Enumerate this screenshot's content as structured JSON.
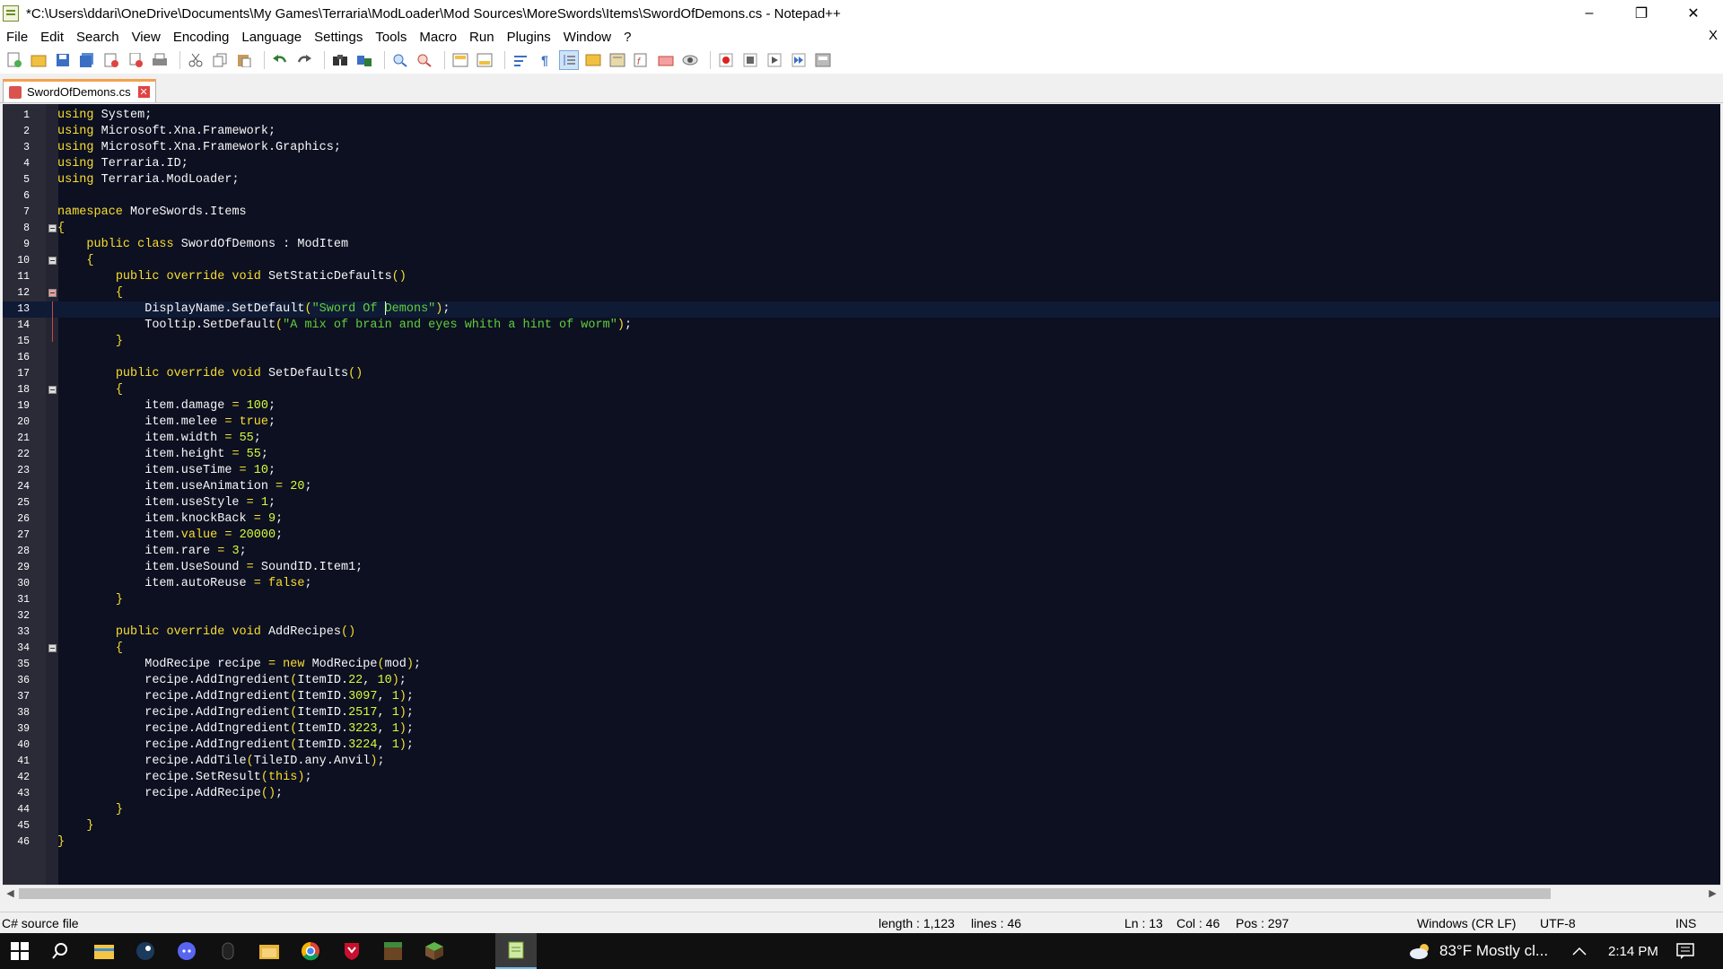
{
  "window": {
    "title": "*C:\\Users\\ddari\\OneDrive\\Documents\\My Games\\Terraria\\ModLoader\\Mod Sources\\MoreSwords\\Items\\SwordOfDemons.cs - Notepad++",
    "minimize": "–",
    "maximize": "❐",
    "close": "✕"
  },
  "menu": {
    "items": [
      "File",
      "Edit",
      "Search",
      "View",
      "Encoding",
      "Language",
      "Settings",
      "Tools",
      "Macro",
      "Run",
      "Plugins",
      "Window",
      "?"
    ],
    "close_doc": "X"
  },
  "toolbar": {
    "icons": [
      "new-file",
      "open-file",
      "save",
      "save-all",
      "close",
      "close-all",
      "print",
      "cut",
      "copy",
      "paste",
      "undo",
      "redo",
      "find",
      "replace",
      "zoom-in",
      "zoom-out",
      "sync-vertical",
      "sync-horizontal",
      "word-wrap",
      "show-all-chars",
      "indent-guide",
      "user-defined-language",
      "folder-as-workspace",
      "function-list",
      "document-map",
      "monitoring",
      "record-macro",
      "stop-recording",
      "play-macro",
      "run-macro-multiple",
      "save-macro"
    ]
  },
  "tab": {
    "label": "SwordOfDemons.cs"
  },
  "code": [
    [
      [
        "kw",
        "using"
      ],
      [
        "t",
        " System;"
      ]
    ],
    [
      [
        "kw",
        "using"
      ],
      [
        "t",
        " Microsoft.Xna.Framework;"
      ]
    ],
    [
      [
        "kw",
        "using"
      ],
      [
        "t",
        " Microsoft.Xna.Framework.Graphics;"
      ]
    ],
    [
      [
        "kw",
        "using"
      ],
      [
        "t",
        " Terraria.ID;"
      ]
    ],
    [
      [
        "kw",
        "using"
      ],
      [
        "t",
        " Terraria.ModLoader;"
      ]
    ],
    [],
    [
      [
        "kw",
        "namespace"
      ],
      [
        "t",
        " MoreSwords.Items"
      ]
    ],
    [
      [
        "kw",
        "{"
      ]
    ],
    [
      [
        "t",
        "    "
      ],
      [
        "kw",
        "public class"
      ],
      [
        "t",
        " SwordOfDemons : ModItem"
      ]
    ],
    [
      [
        "t",
        "    "
      ],
      [
        "kw",
        "{"
      ]
    ],
    [
      [
        "t",
        "        "
      ],
      [
        "kw",
        "public override void"
      ],
      [
        "t",
        " SetStaticDefaults"
      ],
      [
        "kw",
        "()"
      ]
    ],
    [
      [
        "t",
        "        "
      ],
      [
        "kw",
        "{"
      ]
    ],
    [
      [
        "t",
        "            DisplayName.SetDefault"
      ],
      [
        "kw",
        "("
      ],
      [
        "str",
        "\"Sword Of "
      ],
      [
        "caret",
        ""
      ],
      [
        "str",
        "Demons\""
      ],
      [
        "kw",
        ")"
      ],
      [
        "t",
        ";"
      ]
    ],
    [
      [
        "t",
        "            Tooltip.SetDefault"
      ],
      [
        "kw",
        "("
      ],
      [
        "str",
        "\"A mix of brain and eyes whith a hint of worm\""
      ],
      [
        "kw",
        ")"
      ],
      [
        "t",
        ";"
      ]
    ],
    [
      [
        "t",
        "        "
      ],
      [
        "kw",
        "}"
      ]
    ],
    [],
    [
      [
        "t",
        "        "
      ],
      [
        "kw",
        "public override void"
      ],
      [
        "t",
        " SetDefaults"
      ],
      [
        "kw",
        "()"
      ]
    ],
    [
      [
        "t",
        "        "
      ],
      [
        "kw",
        "{"
      ]
    ],
    [
      [
        "t",
        "            item.damage "
      ],
      [
        "kw",
        "="
      ],
      [
        "t",
        " "
      ],
      [
        "num",
        "100"
      ],
      [
        "t",
        ";"
      ]
    ],
    [
      [
        "t",
        "            item.melee "
      ],
      [
        "kw",
        "="
      ],
      [
        "t",
        " "
      ],
      [
        "kw",
        "true"
      ],
      [
        "t",
        ";"
      ]
    ],
    [
      [
        "t",
        "            item.width "
      ],
      [
        "kw",
        "="
      ],
      [
        "t",
        " "
      ],
      [
        "num",
        "55"
      ],
      [
        "t",
        ";"
      ]
    ],
    [
      [
        "t",
        "            item.height "
      ],
      [
        "kw",
        "="
      ],
      [
        "t",
        " "
      ],
      [
        "num",
        "55"
      ],
      [
        "t",
        ";"
      ]
    ],
    [
      [
        "t",
        "            item.useTime "
      ],
      [
        "kw",
        "="
      ],
      [
        "t",
        " "
      ],
      [
        "num",
        "10"
      ],
      [
        "t",
        ";"
      ]
    ],
    [
      [
        "t",
        "            item.useAnimation "
      ],
      [
        "kw",
        "="
      ],
      [
        "t",
        " "
      ],
      [
        "num",
        "20"
      ],
      [
        "t",
        ";"
      ]
    ],
    [
      [
        "t",
        "            item.useStyle "
      ],
      [
        "kw",
        "="
      ],
      [
        "t",
        " "
      ],
      [
        "num",
        "1"
      ],
      [
        "t",
        ";"
      ]
    ],
    [
      [
        "t",
        "            item.knockBack "
      ],
      [
        "kw",
        "="
      ],
      [
        "t",
        " "
      ],
      [
        "num",
        "9"
      ],
      [
        "t",
        ";"
      ]
    ],
    [
      [
        "t",
        "            item."
      ],
      [
        "kw",
        "value"
      ],
      [
        "t",
        " "
      ],
      [
        "kw",
        "="
      ],
      [
        "t",
        " "
      ],
      [
        "num",
        "20000"
      ],
      [
        "t",
        ";"
      ]
    ],
    [
      [
        "t",
        "            item.rare "
      ],
      [
        "kw",
        "="
      ],
      [
        "t",
        " "
      ],
      [
        "num",
        "3"
      ],
      [
        "t",
        ";"
      ]
    ],
    [
      [
        "t",
        "            item.UseSound "
      ],
      [
        "kw",
        "="
      ],
      [
        "t",
        " SoundID.Item1;"
      ]
    ],
    [
      [
        "t",
        "            item.autoReuse "
      ],
      [
        "kw",
        "="
      ],
      [
        "t",
        " "
      ],
      [
        "kw",
        "false"
      ],
      [
        "t",
        ";"
      ]
    ],
    [
      [
        "t",
        "        "
      ],
      [
        "kw",
        "}"
      ]
    ],
    [],
    [
      [
        "t",
        "        "
      ],
      [
        "kw",
        "public override void"
      ],
      [
        "t",
        " AddRecipes"
      ],
      [
        "kw",
        "()"
      ]
    ],
    [
      [
        "t",
        "        "
      ],
      [
        "kw",
        "{"
      ]
    ],
    [
      [
        "t",
        "            ModRecipe recipe "
      ],
      [
        "kw",
        "="
      ],
      [
        "t",
        " "
      ],
      [
        "kw",
        "new"
      ],
      [
        "t",
        " ModRecipe"
      ],
      [
        "kw",
        "("
      ],
      [
        "t",
        "mod"
      ],
      [
        "kw",
        ")"
      ],
      [
        "t",
        ";"
      ]
    ],
    [
      [
        "t",
        "            recipe.AddIngredient"
      ],
      [
        "kw",
        "("
      ],
      [
        "t",
        "ItemID."
      ],
      [
        "num",
        "22"
      ],
      [
        "t",
        ", "
      ],
      [
        "num",
        "10"
      ],
      [
        "kw",
        ")"
      ],
      [
        "t",
        ";"
      ]
    ],
    [
      [
        "t",
        "            recipe.AddIngredient"
      ],
      [
        "kw",
        "("
      ],
      [
        "t",
        "ItemID."
      ],
      [
        "num",
        "3097"
      ],
      [
        "t",
        ", "
      ],
      [
        "num",
        "1"
      ],
      [
        "kw",
        ")"
      ],
      [
        "t",
        ";"
      ]
    ],
    [
      [
        "t",
        "            recipe.AddIngredient"
      ],
      [
        "kw",
        "("
      ],
      [
        "t",
        "ItemID."
      ],
      [
        "num",
        "2517"
      ],
      [
        "t",
        ", "
      ],
      [
        "num",
        "1"
      ],
      [
        "kw",
        ")"
      ],
      [
        "t",
        ";"
      ]
    ],
    [
      [
        "t",
        "            recipe.AddIngredient"
      ],
      [
        "kw",
        "("
      ],
      [
        "t",
        "ItemID."
      ],
      [
        "num",
        "3223"
      ],
      [
        "t",
        ", "
      ],
      [
        "num",
        "1"
      ],
      [
        "kw",
        ")"
      ],
      [
        "t",
        ";"
      ]
    ],
    [
      [
        "t",
        "            recipe.AddIngredient"
      ],
      [
        "kw",
        "("
      ],
      [
        "t",
        "ItemID."
      ],
      [
        "num",
        "3224"
      ],
      [
        "t",
        ", "
      ],
      [
        "num",
        "1"
      ],
      [
        "kw",
        ")"
      ],
      [
        "t",
        ";"
      ]
    ],
    [
      [
        "t",
        "            recipe.AddTile"
      ],
      [
        "kw",
        "("
      ],
      [
        "t",
        "TileID.any.Anvil"
      ],
      [
        "kw",
        ")"
      ],
      [
        "t",
        ";"
      ]
    ],
    [
      [
        "t",
        "            recipe.SetResult"
      ],
      [
        "kw",
        "("
      ],
      [
        "kw",
        "this"
      ],
      [
        "kw",
        ")"
      ],
      [
        "t",
        ";"
      ]
    ],
    [
      [
        "t",
        "            recipe.AddRecipe"
      ],
      [
        "kw",
        "()"
      ],
      [
        "t",
        ";"
      ]
    ],
    [
      [
        "t",
        "        "
      ],
      [
        "kw",
        "}"
      ]
    ],
    [
      [
        "t",
        "    "
      ],
      [
        "kw",
        "}"
      ]
    ],
    [
      [
        "kw",
        "}"
      ]
    ]
  ],
  "current_line": 13,
  "fold_lines": [
    8,
    10,
    12,
    18,
    34
  ],
  "colors": {
    "background": "#0c1021",
    "keyword": "#fbde2d",
    "string": "#61ce3c",
    "number": "#d8fa3c",
    "text": "#f8f8f8"
  },
  "status": {
    "file_type": "C# source file",
    "length": "length : 1,123",
    "lines": "lines : 46",
    "ln": "Ln : 13",
    "col": "Col : 46",
    "pos": "Pos : 297",
    "eol": "Windows (CR LF)",
    "encoding": "UTF-8",
    "mode": "INS"
  },
  "taskbar": {
    "icons": [
      "windows-start-icon",
      "search-icon",
      "file-explorer-icon",
      "steam-icon",
      "discord-icon",
      "mouse-icon",
      "folder-icon",
      "chrome-icon",
      "mcafee-icon",
      "terraria-icon",
      "minecraft-icon",
      "notepadpp-icon"
    ],
    "weather": "83°F  Mostly cl...",
    "time": "2:14 PM"
  }
}
